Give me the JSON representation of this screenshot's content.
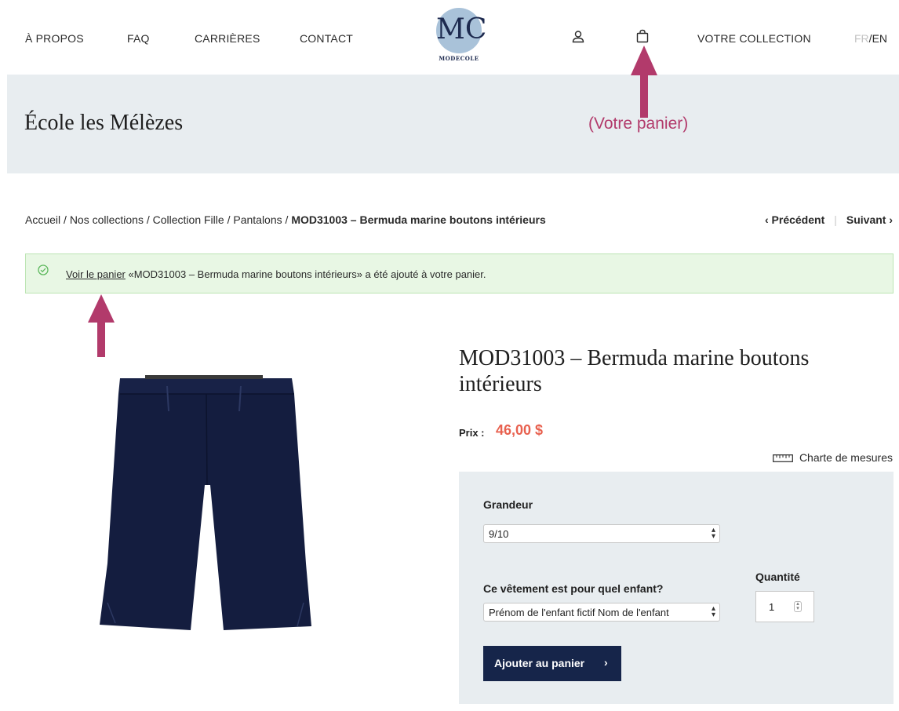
{
  "nav": {
    "about": "À PROPOS",
    "faq": "FAQ",
    "careers": "CARRIÈRES",
    "contact": "CONTACT",
    "collection": "VOTRE COLLECTION"
  },
  "logo": {
    "monogram": "MC",
    "text": "MODECOLE"
  },
  "lang": {
    "fr": "FR",
    "separator": "/",
    "en": "EN"
  },
  "page_title": "École les Mélèzes",
  "annotation": {
    "cart_label": "(Votre panier)",
    "color": "#b23a6b"
  },
  "breadcrumb": {
    "items": [
      "Accueil",
      "Nos collections",
      "Collection Fille",
      "Pantalons"
    ],
    "separator": " / ",
    "current": "MOD31003 – Bermuda marine boutons intérieurs"
  },
  "pager": {
    "prev": "‹  Précédent",
    "next": "Suivant  ›"
  },
  "notice": {
    "link": "Voir le panier",
    "message": " «MOD31003 – Bermuda marine boutons intérieurs» a été ajouté à votre panier."
  },
  "product": {
    "title": "MOD31003 – Bermuda marine boutons intérieurs",
    "price_label": "Prix :",
    "price_value": "46,00  $",
    "size_chart": "Charte de mesures",
    "garment_color": "#141d3f"
  },
  "options": {
    "size_label": "Grandeur",
    "size_value": "9/10",
    "child_label": "Ce vêtement est pour quel enfant?",
    "child_value": "Prénom de l'enfant fictif Nom de l'enfant",
    "qty_label": "Quantité",
    "qty_value": "1",
    "add_button": "Ajouter au panier",
    "add_button_chevron": "›"
  },
  "colors": {
    "accent_price": "#e8614f",
    "button": "#16254a",
    "band": "#e8edf0",
    "notice_bg": "#e8f7e4"
  }
}
